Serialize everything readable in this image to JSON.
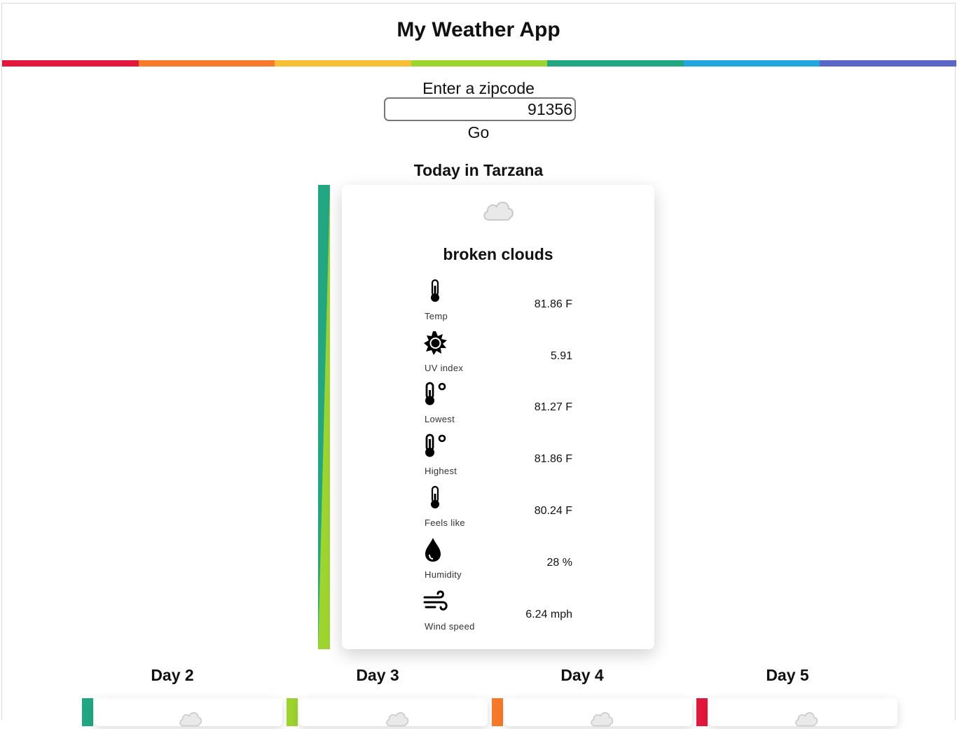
{
  "app": {
    "title": "My Weather App"
  },
  "rainbow_colors": [
    "#e3173b",
    "#f77a2b",
    "#f7be36",
    "#9dd42e",
    "#21a883",
    "#22a6e0",
    "#5a66c8"
  ],
  "search": {
    "label": "Enter a zipcode",
    "value": "91356",
    "go_label": "Go"
  },
  "today": {
    "heading": "Today in Tarzana",
    "condition": "broken clouds",
    "icon": "cloud-icon",
    "stats": [
      {
        "label": "Temp",
        "value": "81.86 F",
        "icon": "thermometer-icon"
      },
      {
        "label": "UV index",
        "value": "5.91",
        "icon": "sun-icon"
      },
      {
        "label": "Lowest",
        "value": "81.27 F",
        "icon": "thermometer-degree-icon"
      },
      {
        "label": "Highest",
        "value": "81.86 F",
        "icon": "thermometer-degree-icon"
      },
      {
        "label": "Feels like",
        "value": "80.24 F",
        "icon": "thermometer-icon"
      },
      {
        "label": "Humidity",
        "value": "28 %",
        "icon": "droplet-icon"
      },
      {
        "label": "Wind speed",
        "value": "6.24 mph",
        "icon": "wind-icon"
      }
    ]
  },
  "forecast": [
    {
      "label": "Day 2",
      "stripe_color": "#21a883"
    },
    {
      "label": "Day 3",
      "stripe_color": "#9dd42e"
    },
    {
      "label": "Day 4",
      "stripe_color": "#f77a2b"
    },
    {
      "label": "Day 5",
      "stripe_color": "#e3173b"
    }
  ]
}
